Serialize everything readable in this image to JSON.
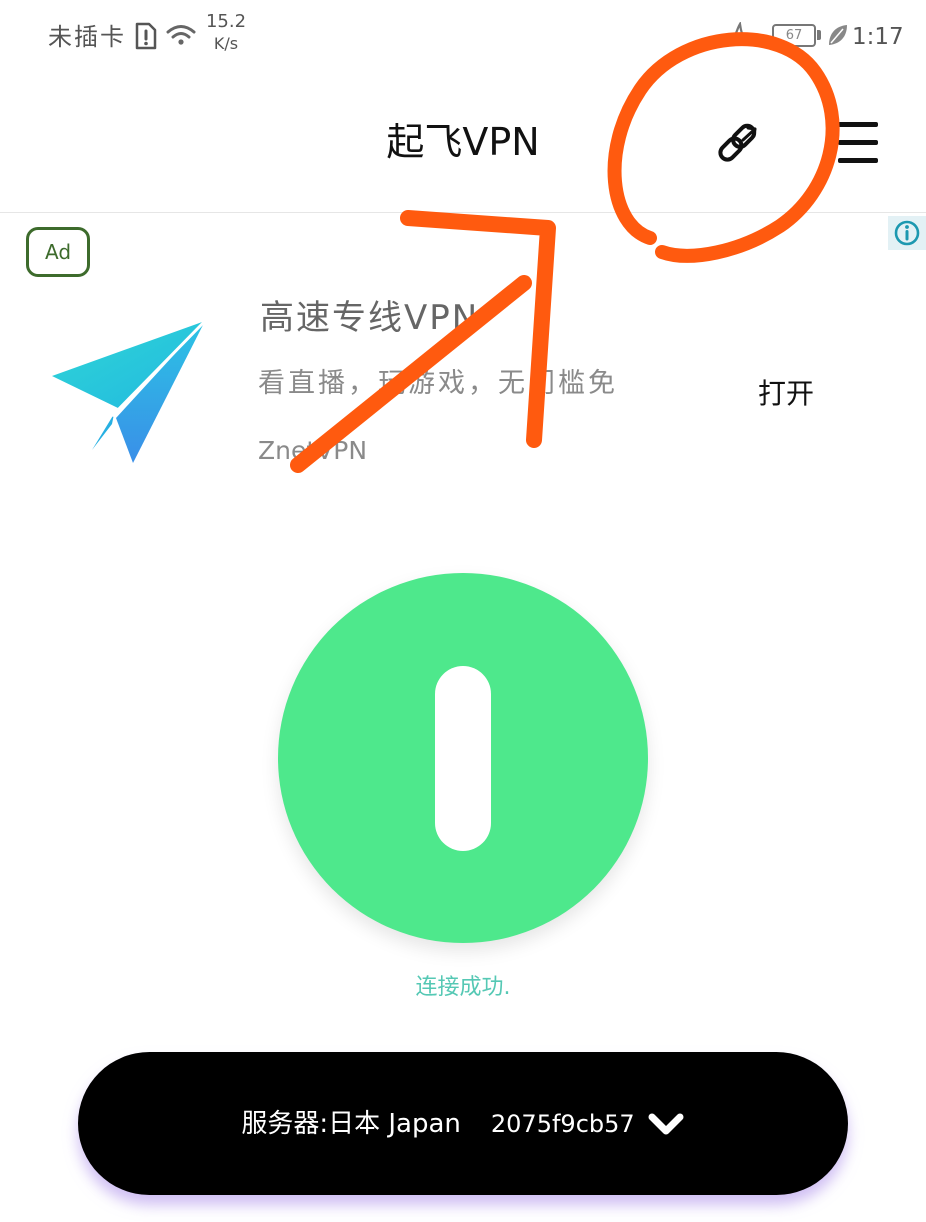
{
  "status_bar": {
    "carrier": "未插卡",
    "speed_value": "15.2",
    "speed_unit": "K/s",
    "battery_level": "67",
    "time": "1:17"
  },
  "header": {
    "title": "起飞VPN"
  },
  "ad": {
    "badge": "Ad",
    "app_title": "高速专线VPN",
    "description": "看直播，玩游戏，无门槛免",
    "app_name": "ZnetVPN",
    "open_label": "打开"
  },
  "connection": {
    "status_text": "连接成功."
  },
  "server_selector": {
    "label": "服务器:日本 Japan",
    "server_id": "2075f9cb57"
  },
  "icons": {
    "status_bar": [
      "sim-alert-icon",
      "wifi-icon",
      "flame-icon",
      "battery-icon",
      "leaf-icon"
    ],
    "header": [
      "link-icon",
      "menu-icon"
    ],
    "ad": [
      "info-icon",
      "paper-plane-app-icon"
    ],
    "power": [
      "power-toggle-icon"
    ],
    "server_selector": [
      "chevron-down-icon"
    ]
  },
  "colors": {
    "power_button": "#4EE88C",
    "connection_status_text": "#55C8B4",
    "ad_badge": "#3D6B2C",
    "server_bar_background": "#000000",
    "server_bar_glow": "#A98BEA",
    "annotation": "#FF5A0F"
  }
}
